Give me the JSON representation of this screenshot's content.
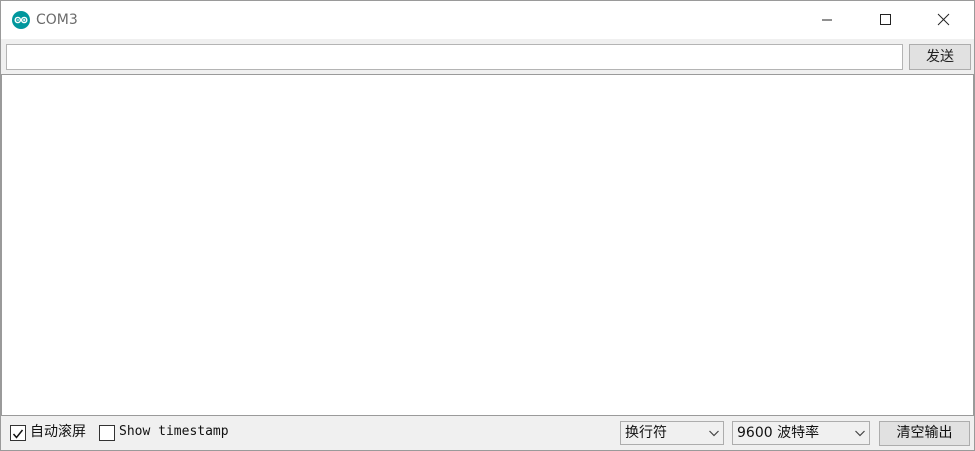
{
  "window": {
    "title": "COM3",
    "icon": "arduino-icon",
    "accent_color": "#00979d"
  },
  "input_row": {
    "value": "",
    "send_label": "发送"
  },
  "output": {
    "text": ""
  },
  "bottom_bar": {
    "autoscroll_label": "自动滚屏",
    "autoscroll_checked": true,
    "timestamp_label": "Show timestamp",
    "timestamp_checked": false,
    "line_ending_value": "换行符",
    "baud_value": "9600 波特率",
    "clear_label": "清空输出"
  }
}
